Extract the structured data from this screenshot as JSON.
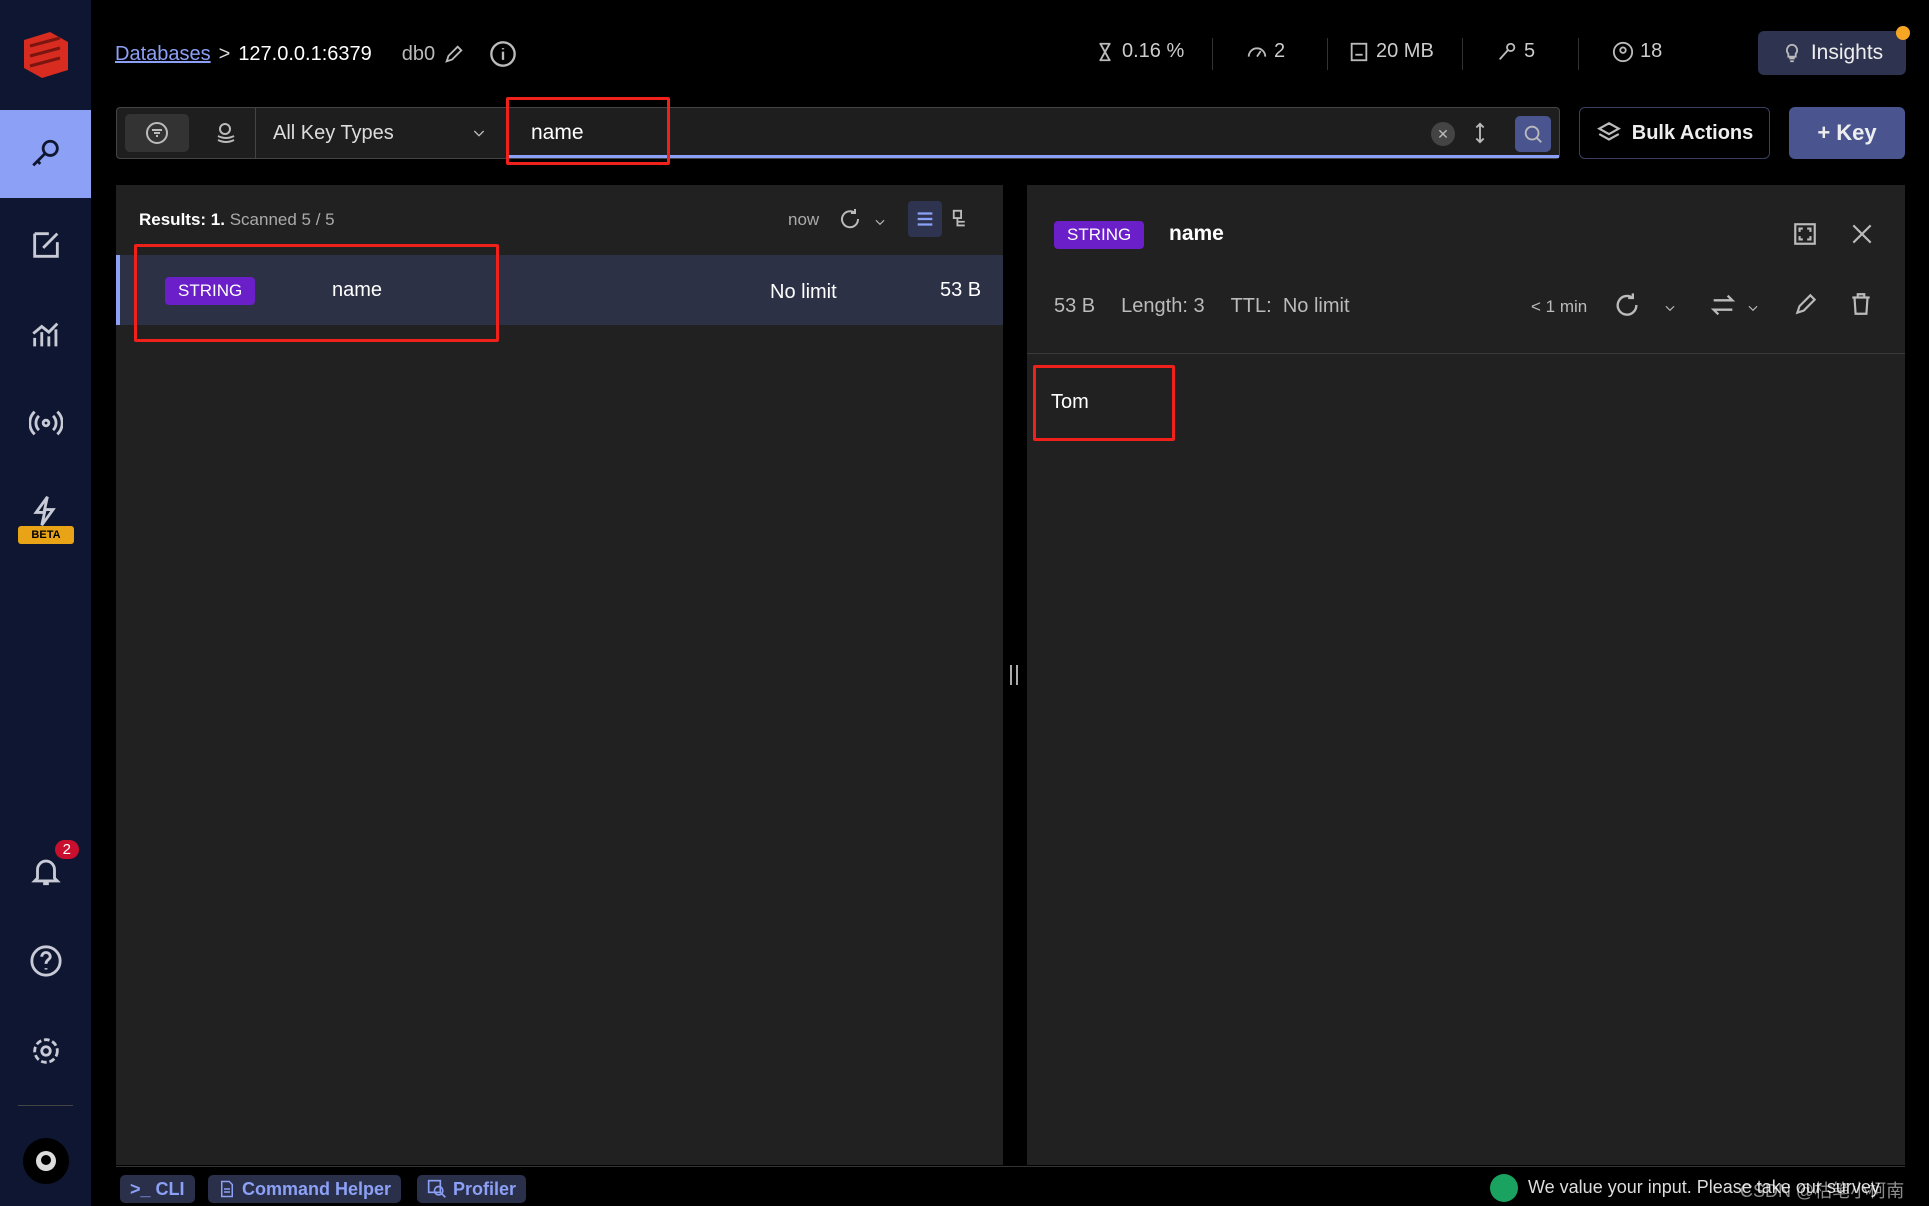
{
  "header": {
    "breadcrumb_link": "Databases",
    "separator": ">",
    "host": "127.0.0.1:6379",
    "db": "db0",
    "stats": {
      "cpu": "0.16 %",
      "ops": "2",
      "memory": "20 MB",
      "keys": "5",
      "clients": "18"
    },
    "insights_label": "Insights"
  },
  "sidebar": {
    "beta_label": "BETA",
    "notifications_count": "2",
    "active": "browser"
  },
  "search": {
    "key_type": "All Key Types",
    "value": "name",
    "bulk_actions": "Bulk Actions",
    "add_key": "+ Key"
  },
  "list": {
    "results_label": "Results: 1.",
    "scanned": "Scanned 5 / 5",
    "refreshed": "now",
    "rows": [
      {
        "type": "STRING",
        "name": "name",
        "ttl": "No limit",
        "size": "53 B"
      }
    ]
  },
  "details": {
    "type": "STRING",
    "name": "name",
    "size": "53 B",
    "length": "Length: 3",
    "ttl_label": "TTL:",
    "ttl": "No limit",
    "refreshed": "< 1 min",
    "value": "Tom"
  },
  "footer": {
    "cli": ">_ CLI",
    "command_helper": "Command Helper",
    "profiler": "Profiler",
    "feedback": "We value your input. Please take our survey",
    "watermark": "CSDN @枯笔小柯南"
  },
  "colors": {
    "accent": "#8ca0f5",
    "string_badge": "#6a1fc8",
    "highlight": "#f0201a"
  }
}
